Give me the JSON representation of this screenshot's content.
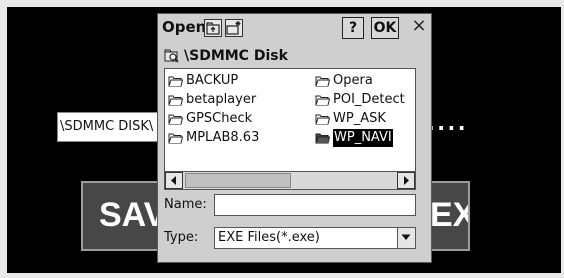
{
  "background": {
    "path_value": "\\SDMMC DISK\\",
    "browse_label": ".....",
    "save_label": "SAVE",
    "exit_label": "EXIT"
  },
  "dialog": {
    "title": "Open",
    "help_label": "?",
    "ok_label": "OK",
    "close_label": "×",
    "location": "\\SDMMC Disk",
    "files": [
      {
        "label": "BACKUP"
      },
      {
        "label": "betaplayer"
      },
      {
        "label": "GPSCheck"
      },
      {
        "label": "MPLAB8.63"
      },
      {
        "label": "Opera"
      },
      {
        "label": "POI_Detect"
      },
      {
        "label": "WP_ASK"
      },
      {
        "label": "WP_NAVI",
        "selected": true
      }
    ],
    "name_label": "Name:",
    "name_value": "",
    "type_label": "Type:",
    "type_value": "EXE Files(*.exe)"
  }
}
